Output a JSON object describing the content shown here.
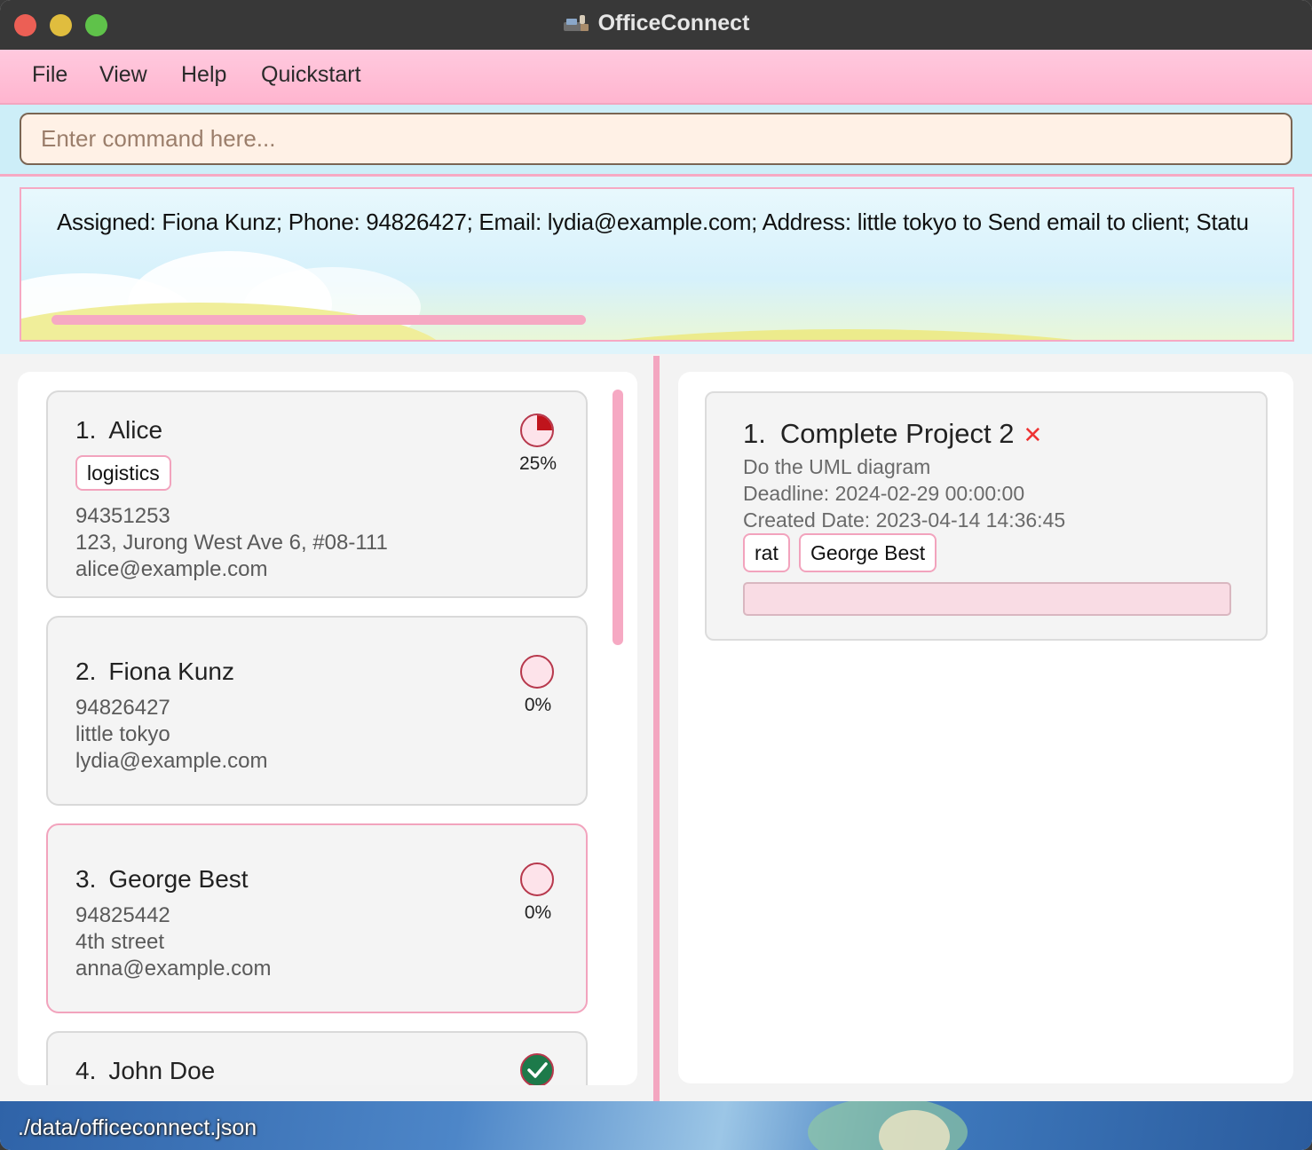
{
  "window": {
    "title": "OfficeConnect",
    "app_icon": "app-logo-icon"
  },
  "menu": {
    "items": [
      "File",
      "View",
      "Help",
      "Quickstart"
    ]
  },
  "command": {
    "placeholder": "Enter command here...",
    "value": ""
  },
  "result": {
    "text": "Assigned: Fiona Kunz; Phone: 94826427; Email: lydia@example.com; Address: little tokyo to Send email to client; Statu"
  },
  "persons": [
    {
      "index": "1.",
      "name": "Alice",
      "tags": [
        "logistics"
      ],
      "phone": "94351253",
      "address": "123, Jurong West Ave 6, #08-111",
      "email": "alice@example.com",
      "progress_label": "25%",
      "progress": 0.25
    },
    {
      "index": "2.",
      "name": "Fiona Kunz",
      "tags": [],
      "phone": "94826427",
      "address": "little tokyo",
      "email": "lydia@example.com",
      "progress_label": "0%",
      "progress": 0
    },
    {
      "index": "3.",
      "name": "George Best",
      "tags": [],
      "phone": "94825442",
      "address": "4th street",
      "email": "anna@example.com",
      "progress_label": "0%",
      "progress": 0
    },
    {
      "index": "4.",
      "name": "John Doe",
      "status_icon": "check-circle-icon"
    }
  ],
  "tasks": [
    {
      "index": "1.",
      "title": "Complete Project 2",
      "status_icon": "cross-icon",
      "status_glyph": "✕",
      "description": "Do the UML diagram",
      "deadline": "Deadline: 2024-02-29 00:00:00",
      "created": "Created Date: 2023-04-14 14:36:45",
      "tags": [
        "rat",
        "George Best"
      ]
    }
  ],
  "status": {
    "path": "./data/officeconnect.json"
  },
  "colors": {
    "accent_pink": "#f6a9c3",
    "menubar": "#ffb5cf",
    "titlebar": "#383838",
    "pie_fill": "#c0141c",
    "done_green": "#1d7a4a"
  }
}
